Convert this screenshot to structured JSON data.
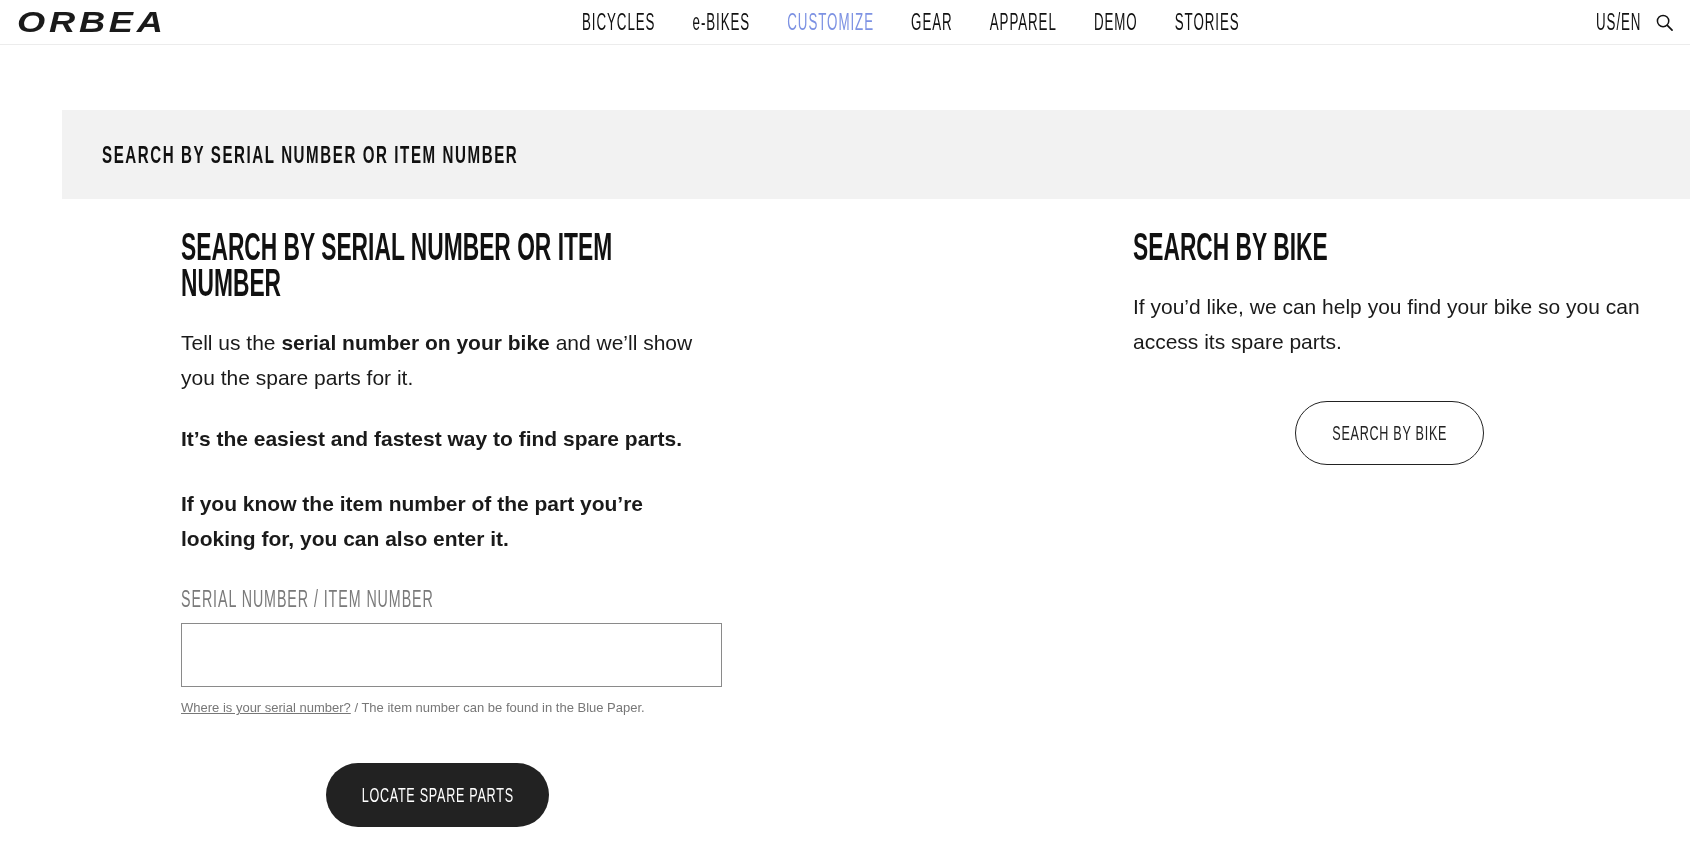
{
  "header": {
    "logo": "ORBEA",
    "nav": [
      {
        "label": "BICYCLES",
        "selected": false
      },
      {
        "label": "e-BIKES",
        "selected": false
      },
      {
        "label": "CUSTOMIZE",
        "selected": true
      },
      {
        "label": "GEAR",
        "selected": false
      },
      {
        "label": "APPAREL",
        "selected": false
      },
      {
        "label": "DEMO",
        "selected": false
      },
      {
        "label": "STORIES",
        "selected": false
      }
    ],
    "locale": "US/EN"
  },
  "banner": {
    "title": "SEARCH BY SERIAL NUMBER OR ITEM NUMBER"
  },
  "serial_search": {
    "title": "SEARCH BY SERIAL NUMBER OR ITEM NUMBER",
    "paragraphs": [
      {
        "kind": "body",
        "text": "Tell us the **serial number on your bike** and we’ll show you the spare parts for it."
      },
      {
        "kind": "emphasis",
        "text": "It’s the easiest and fastest way to find spare parts."
      },
      {
        "kind": "emphasis",
        "text": "If you know the item number of the part you’re looking for, you can also enter it."
      }
    ],
    "field": {
      "label": "SERIAL NUMBER / ITEM NUMBER"
    },
    "hint": {
      "link": "Where is your serial number?",
      "text": " / The item number can be found in the Blue Paper."
    },
    "button": "LOCATE SPARE PARTS"
  },
  "bike_search": {
    "title": "SEARCH BY BIKE",
    "text": "If you’d like, we can help you find your bike so you can access its spare parts.",
    "button": "SEARCH BY BIKE"
  }
}
